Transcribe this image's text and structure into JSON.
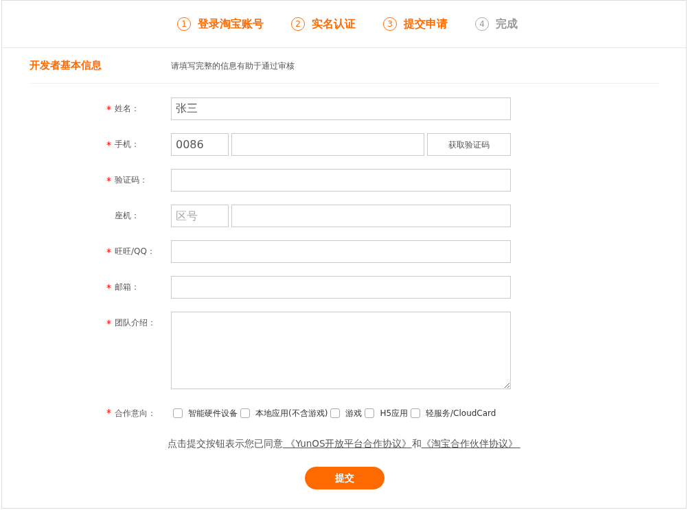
{
  "steps": [
    {
      "number": "1",
      "label": "登录淘宝账号",
      "active": true
    },
    {
      "number": "2",
      "label": "实名认证",
      "active": true
    },
    {
      "number": "3",
      "label": "提交申请",
      "active": true
    },
    {
      "number": "4",
      "label": "完成",
      "active": false
    }
  ],
  "section": {
    "title": "开发者基本信息",
    "hint": "请填写完整的信息有助于通过审核"
  },
  "fields": [
    {
      "kind": "text",
      "required_mark": "*",
      "label": "姓名：",
      "value": "张三"
    },
    {
      "kind": "phone",
      "required_mark": "*",
      "label": "手机：",
      "prefix_value": "0086",
      "button": "获取验证码"
    },
    {
      "kind": "text",
      "required_mark": "*",
      "label": "验证码："
    },
    {
      "kind": "landline",
      "label": "座机：",
      "prefix_placeholder": "区号"
    },
    {
      "kind": "text",
      "required_mark": "*",
      "label": "旺旺/QQ："
    },
    {
      "kind": "text",
      "required_mark": "*",
      "label": "邮箱："
    },
    {
      "kind": "textarea",
      "required_mark": "*",
      "label": "团队介绍："
    }
  ],
  "cooperation": {
    "required_mark": "*",
    "label": "合作意向：",
    "options": [
      {
        "label": "智能硬件设备",
        "checked": false
      },
      {
        "label": "本地应用(不含游戏)",
        "checked": false
      },
      {
        "label": "游戏",
        "checked": false
      },
      {
        "label": "H5应用",
        "checked": false
      },
      {
        "label": "轻服务/CloudCard",
        "checked": false
      }
    ]
  },
  "agreement": [
    {
      "kind": "text",
      "text": "点击提交按钮表示您已同意"
    },
    {
      "kind": "link",
      "text": " 《YunOS开放平台合作协议》"
    },
    {
      "kind": "text",
      "text": "和"
    },
    {
      "kind": "link",
      "text": "《淘宝合作伙伴协议》 "
    }
  ],
  "submit": "提交"
}
